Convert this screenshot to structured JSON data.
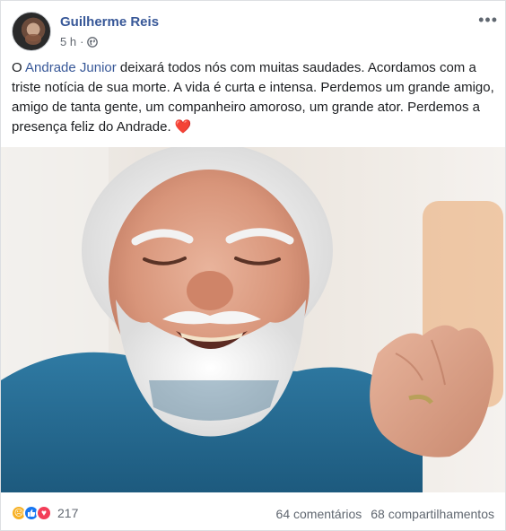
{
  "post": {
    "author": "Guilherme Reis",
    "time": "5 h",
    "separator": "·",
    "menu_label": "•••",
    "text": {
      "prefix": "O ",
      "mention": "Andrade Junior",
      "body": " deixará todos nós com muitas saudades. Acordamos com a triste notícia de sua morte. A vida é curta e intensa. Perdemos um grande amigo, amigo de tanta gente, um companheiro amoroso, um grande ator. Perdemos a presença feliz do Andrade. ",
      "emoji": "❤️"
    }
  },
  "footer": {
    "reaction_count": "217",
    "comments": "64 comentários",
    "shares": "68 compartilhamentos",
    "reactions": [
      {
        "icon": "sad-reaction-icon",
        "glyph": "☹",
        "color": "#f7b125"
      },
      {
        "icon": "like-reaction-icon",
        "glyph": "👍",
        "color": "#1877f2"
      },
      {
        "icon": "love-reaction-icon",
        "glyph": "♥",
        "color": "#f33e58"
      }
    ]
  },
  "colors": {
    "link": "#385898",
    "meta": "#616770",
    "heart": "#e41e3f"
  }
}
